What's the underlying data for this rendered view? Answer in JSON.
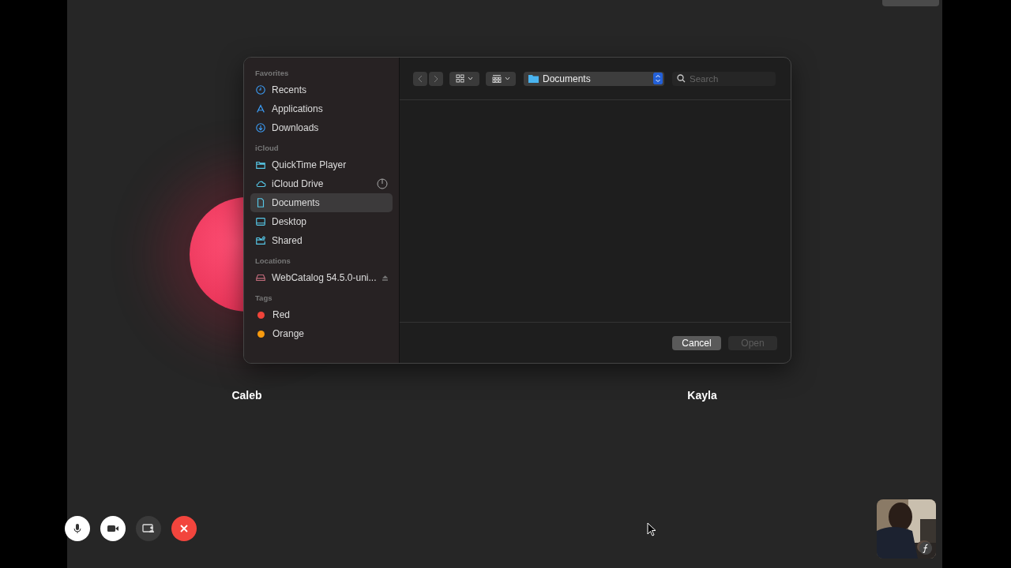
{
  "participants": [
    {
      "name": "Caleb",
      "avatar": true
    },
    {
      "name": "Kayla",
      "avatar": false
    }
  ],
  "dialog": {
    "sidebar": [
      {
        "heading": "Favorites",
        "items": [
          {
            "label": "Recents",
            "kind": "clock",
            "selected": false
          },
          {
            "label": "Applications",
            "kind": "apps",
            "selected": false
          },
          {
            "label": "Downloads",
            "kind": "download",
            "selected": false
          }
        ]
      },
      {
        "heading": "iCloud",
        "items": [
          {
            "label": "QuickTime Player",
            "kind": "folder",
            "selected": false
          },
          {
            "label": "iCloud Drive",
            "kind": "cloud",
            "selected": false,
            "progress": true
          },
          {
            "label": "Documents",
            "kind": "doc",
            "selected": true
          },
          {
            "label": "Desktop",
            "kind": "desktop",
            "selected": false
          },
          {
            "label": "Shared",
            "kind": "shared",
            "selected": false
          }
        ]
      },
      {
        "heading": "Locations",
        "items": [
          {
            "label": "WebCatalog 54.5.0-uni...",
            "kind": "drive",
            "selected": false,
            "eject": true
          }
        ]
      },
      {
        "heading": "Tags",
        "items": [
          {
            "label": "Red",
            "kind": "tag",
            "color": "#f0443a",
            "selected": false
          },
          {
            "label": "Orange",
            "kind": "tag",
            "color": "#f79a0e",
            "selected": false
          }
        ]
      }
    ],
    "location": "Documents",
    "search": {
      "placeholder": "Search"
    },
    "buttons": [
      {
        "label": "Cancel",
        "disabled": false
      },
      {
        "label": "Open",
        "disabled": true
      }
    ]
  },
  "controls": [
    {
      "kind": "mic",
      "on": true
    },
    {
      "kind": "camera",
      "on": true
    },
    {
      "kind": "share",
      "on": false
    },
    {
      "kind": "end"
    }
  ]
}
